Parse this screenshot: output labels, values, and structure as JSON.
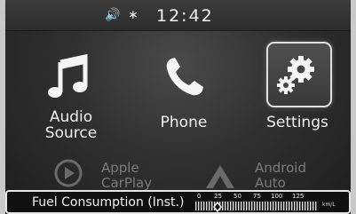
{
  "status": {
    "volume_icon": "speaker-volume-icon",
    "bluetooth_icon": "bluetooth-icon",
    "time": "12:42"
  },
  "apps": [
    {
      "id": "audio",
      "label_line1": "Audio",
      "label_line2": "Source",
      "icon": "music-note-icon"
    },
    {
      "id": "phone",
      "label_line1": "Phone",
      "label_line2": "",
      "icon": "phone-handset-icon"
    },
    {
      "id": "settings",
      "label_line1": "Settings",
      "label_line2": "",
      "icon": "gears-icon",
      "selected": true
    }
  ],
  "secondary_apps": [
    {
      "id": "carplay",
      "label_line1": "Apple",
      "label_line2": "CarPlay",
      "icon": "play-circle-icon"
    },
    {
      "id": "android",
      "label_line1": "Android",
      "label_line2": "Auto",
      "icon": "android-auto-icon"
    }
  ],
  "fuel": {
    "label": "Fuel Consumption (Inst.)",
    "ticks": [
      "0",
      "25",
      "50",
      "75",
      "100",
      "125"
    ],
    "unit": "km/L",
    "indicator_value": 25
  },
  "colors": {
    "accent_border": "#e6e6e6",
    "background": "#2e2e2e"
  }
}
